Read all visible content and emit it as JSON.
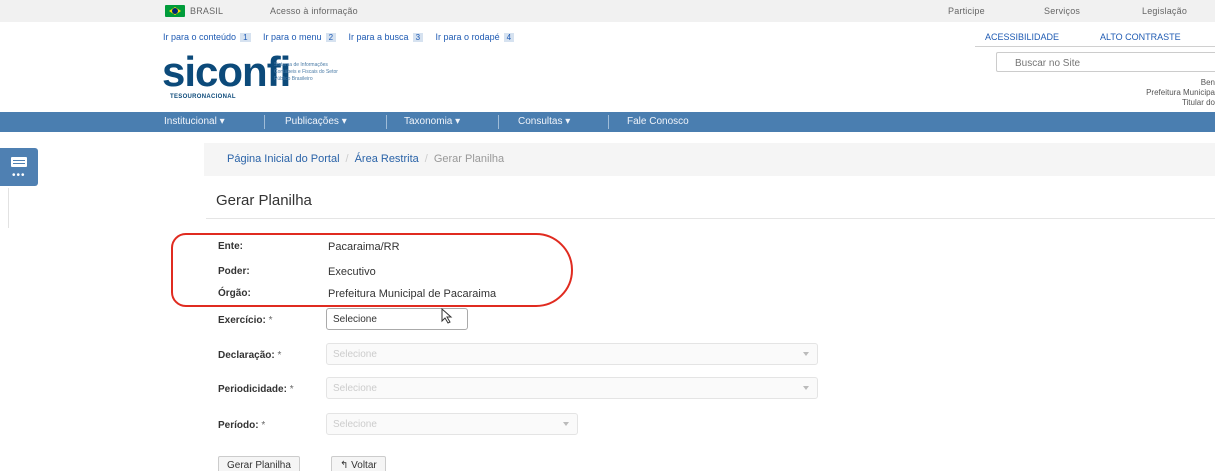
{
  "gov_bar": {
    "brasil_label": "BRASIL",
    "acesso_label": "Acesso à informação",
    "links": [
      "Participe",
      "Serviços",
      "Legislação"
    ]
  },
  "skip_links": [
    {
      "label": "Ir para o conteúdo",
      "num": "1"
    },
    {
      "label": "Ir para o menu",
      "num": "2"
    },
    {
      "label": "Ir para a busca",
      "num": "3"
    },
    {
      "label": "Ir para o rodapé",
      "num": "4"
    }
  ],
  "accessibility": {
    "acessibilidade": "ACESSIBILIDADE",
    "alto_contraste": "ALTO CONTRASTE"
  },
  "logo": {
    "word": "siconfi",
    "subtitle": "Sistema de Informações Contábeis e Fiscais do Setor Público Brasileiro",
    "tesouro": "TESOURONACIONAL"
  },
  "search": {
    "placeholder": "Buscar no Site"
  },
  "user_info": {
    "line1": "Ben",
    "line2": "Prefeitura Municipa",
    "line3": "Titular do"
  },
  "nav": {
    "items": [
      "Institucional ▾",
      "Publicações ▾",
      "Taxonomia ▾",
      "Consultas ▾",
      "Fale Conosco"
    ]
  },
  "side_widget": {
    "dots": "•••"
  },
  "breadcrumb": {
    "home": "Página Inicial do Portal",
    "restricted": "Área Restrita",
    "current": "Gerar Planilha",
    "separator": "/"
  },
  "page": {
    "title": "Gerar Planilha"
  },
  "info": [
    {
      "label": "Ente:",
      "value": "Pacaraima/RR"
    },
    {
      "label": "Poder:",
      "value": "Executivo"
    },
    {
      "label": "Órgão:",
      "value": "Prefeitura Municipal de Pacaraima"
    }
  ],
  "form": {
    "required_mark": "*",
    "exercicio": {
      "label": "Exercício:",
      "value": "Selecione"
    },
    "declaracao": {
      "label": "Declaração:",
      "value": "Selecione"
    },
    "periodicidade": {
      "label": "Periodicidade:",
      "value": "Selecione"
    },
    "periodo": {
      "label": "Período:",
      "value": "Selecione"
    }
  },
  "buttons": {
    "generate": "Gerar Planilha",
    "back": "↰ Voltar"
  },
  "colors": {
    "nav_bg": "#4a7eb0",
    "highlight": "#e02b20",
    "link": "#2a63a8",
    "brand": "#0c4a7a"
  }
}
